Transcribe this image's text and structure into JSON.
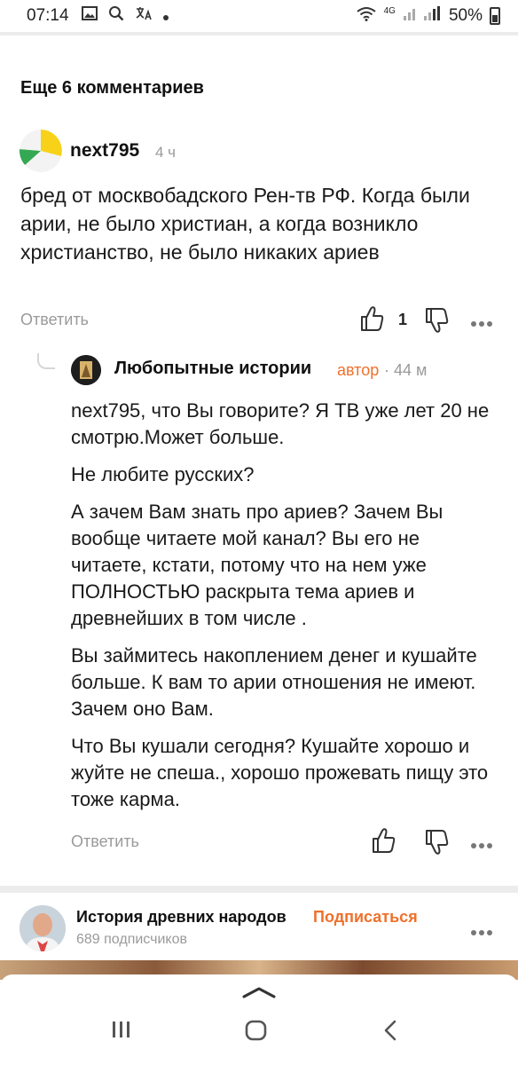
{
  "status_bar": {
    "time": "07:14",
    "network": "4G",
    "battery": "50%"
  },
  "comments": {
    "more_label": "Еще 6 комментариев",
    "comment": {
      "username": "next795",
      "time_ago": "4 ч",
      "text": "бред от москвобадского Рен-тв РФ. Когда были арии, не было христиан, а когда возникло христианство, не было никаких ариев",
      "reply_label": "Ответить",
      "like_count": "1"
    },
    "reply": {
      "author_name": "Любопытные истории",
      "author_badge": "автор",
      "time_ago": "· 44 м",
      "paragraphs": [
        "next795, что Вы говорите? Я ТВ уже лет 20 не смотрю.Может больше.",
        "Не любите русских?",
        "А зачем Вам знать про ариев? Зачем Вы вообще читаете мой канал? Вы его не читаете, кстати, потому что на нем уже ПОЛНОСТЬЮ раскрыта тема ариев и древнейших в том числе .",
        "Вы займитесь накоплением денег и кушайте больше. К вам то арии отношения не имеют. Зачем оно Вам.",
        "Что Вы кушали сегодня? Кушайте хорошо и жуйте не спеша., хорошо прожевать пищу это тоже карма."
      ],
      "reply_label": "Ответить"
    }
  },
  "channel": {
    "name": "История древних народов",
    "subscribe_label": "Подписаться",
    "subscribers": "689 подписчиков"
  },
  "colors": {
    "accent": "#f0702a",
    "muted": "#9a9a9a",
    "divider": "#ececec"
  },
  "icons": [
    "gallery-icon",
    "search-icon",
    "translate-icon",
    "wifi-icon",
    "signal-icon",
    "battery-icon",
    "like-icon",
    "dislike-icon",
    "more-icon",
    "chevron-up-icon",
    "recent-apps-icon",
    "home-icon",
    "back-icon"
  ]
}
